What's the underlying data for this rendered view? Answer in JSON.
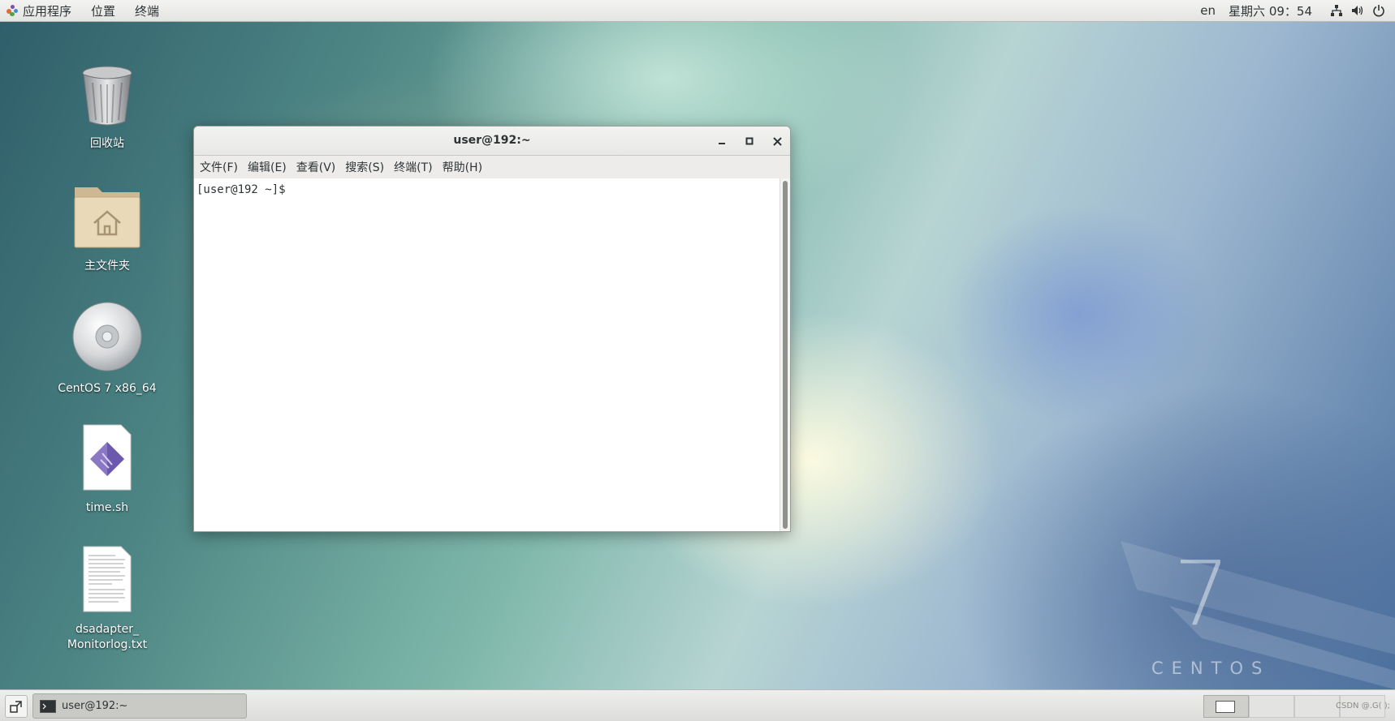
{
  "topbar": {
    "applications": "应用程序",
    "places": "位置",
    "terminal": "终端",
    "language": "en",
    "datetime": "星期六 09：54",
    "icons": [
      "network-icon",
      "volume-icon",
      "power-icon"
    ]
  },
  "desktop": {
    "icons": [
      {
        "label": "回收站",
        "icon": "trash-icon"
      },
      {
        "label": "主文件夹",
        "icon": "home-folder-icon"
      },
      {
        "label": "CentOS 7 x86_64",
        "icon": "disc-icon"
      },
      {
        "label": "time.sh",
        "icon": "script-file-icon"
      },
      {
        "label": "dsadapter_\nMonitorlog.txt",
        "icon": "text-file-icon"
      }
    ],
    "watermark_number": "7",
    "watermark_word": "CENTOS"
  },
  "terminal_window": {
    "title": "user@192:~",
    "menu": [
      "文件(F)",
      "编辑(E)",
      "查看(V)",
      "搜索(S)",
      "终端(T)",
      "帮助(H)"
    ],
    "prompt": "[user@192 ~]$ "
  },
  "taskbar": {
    "task_label": "user@192:~",
    "credit": "CSDN @.G( );"
  },
  "colors": {
    "panel": "#e9e9e7",
    "text": "#2e3436",
    "window_bg": "#ffffff"
  }
}
